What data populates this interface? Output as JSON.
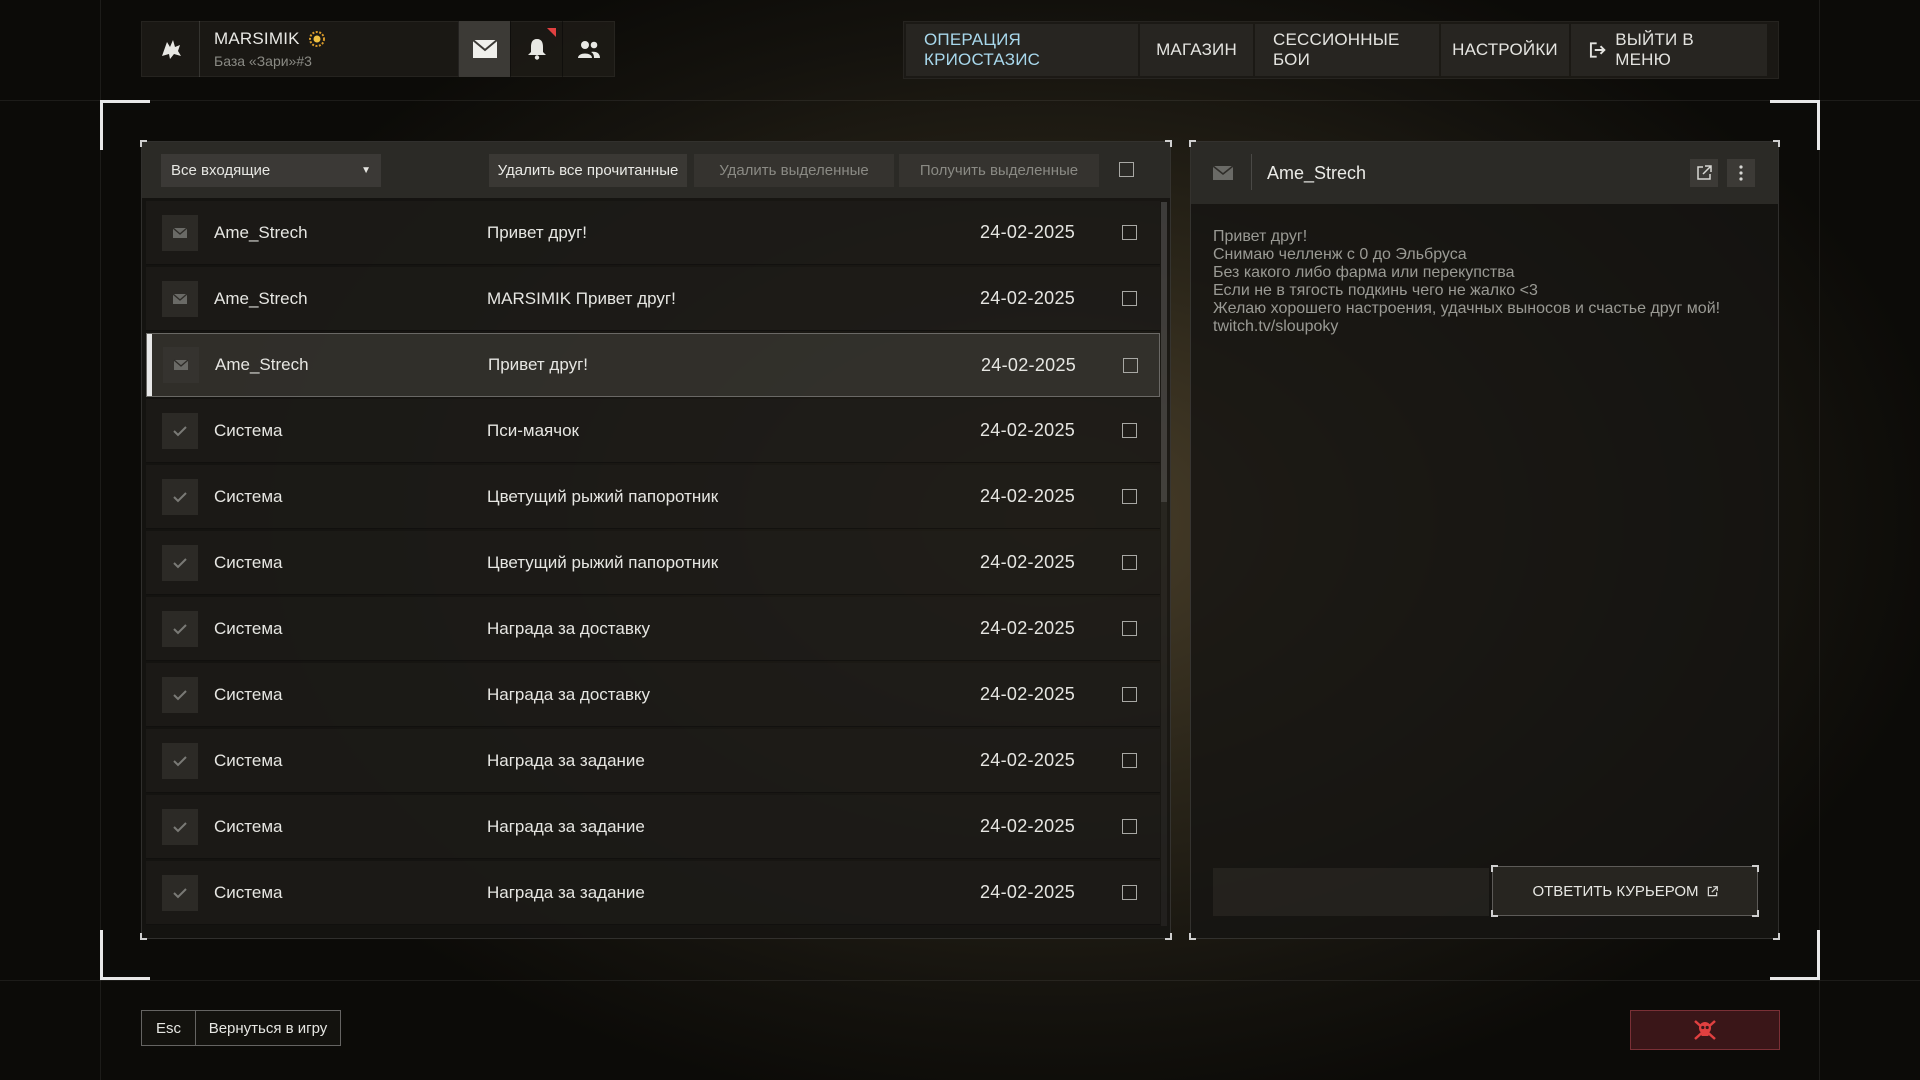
{
  "profile": {
    "name": "MARSIMIK",
    "base": "База «Зари»#3",
    "icons": [
      "wolf-logo-icon",
      "mail-icon",
      "bell-icon",
      "friends-icon"
    ]
  },
  "nav": {
    "items": [
      "ОПЕРАЦИЯ КРИОСТАЗИС",
      "МАГАЗИН",
      "СЕССИОННЫЕ БОИ",
      "НАСТРОЙКИ"
    ],
    "exit_label": "ВЫЙТИ В МЕНЮ",
    "active_color": "#a8d8ec"
  },
  "inbox": {
    "filter": "Все входящие",
    "delete_read": "Удалить все прочитанные",
    "delete_selected": "Удалить выделенные",
    "receive_selected": "Получить выделенные",
    "messages": [
      {
        "sender": "Ame_Strech",
        "subject": "Привет друг!",
        "date": "24-02-2025",
        "icon": "mail-icon",
        "selected": false
      },
      {
        "sender": "Ame_Strech",
        "subject": "MARSIMIK Привет друг!",
        "date": "24-02-2025",
        "icon": "mail-icon",
        "selected": false
      },
      {
        "sender": "Ame_Strech",
        "subject": "Привет друг!",
        "date": "24-02-2025",
        "icon": "mail-icon",
        "selected": true
      },
      {
        "sender": "Система",
        "subject": "Пси-маячок",
        "date": "24-02-2025",
        "icon": "check-icon",
        "selected": false
      },
      {
        "sender": "Система",
        "subject": "Цветущий рыжий папоротник",
        "date": "24-02-2025",
        "icon": "check-icon",
        "selected": false
      },
      {
        "sender": "Система",
        "subject": "Цветущий рыжий папоротник",
        "date": "24-02-2025",
        "icon": "check-icon",
        "selected": false
      },
      {
        "sender": "Система",
        "subject": "Награда за доставку",
        "date": "24-02-2025",
        "icon": "check-icon",
        "selected": false
      },
      {
        "sender": "Система",
        "subject": "Награда за доставку",
        "date": "24-02-2025",
        "icon": "check-icon",
        "selected": false
      },
      {
        "sender": "Система",
        "subject": "Награда за задание",
        "date": "24-02-2025",
        "icon": "check-icon",
        "selected": false
      },
      {
        "sender": "Система",
        "subject": "Награда за задание",
        "date": "24-02-2025",
        "icon": "check-icon",
        "selected": false
      },
      {
        "sender": "Система",
        "subject": "Награда за задание",
        "date": "24-02-2025",
        "icon": "check-icon",
        "selected": false
      }
    ]
  },
  "message": {
    "sender": "Ame_Strech",
    "body": [
      "Привет друг!",
      "Снимаю челленж с 0 до Эльбруса",
      "Без какого либо фарма или перекупства",
      "Если не в тягость подкинь чего не жалко <3",
      "Желаю хорошего настроения, удачных выносов и счастье друг мой!",
      "twitch.tv/sloupoky"
    ],
    "reply_label": "ОТВЕТИТЬ КУРЬЕРОМ"
  },
  "footer": {
    "esc_key": "Esc",
    "back_label": "Вернуться в игру",
    "danger_color": "#e04040"
  }
}
